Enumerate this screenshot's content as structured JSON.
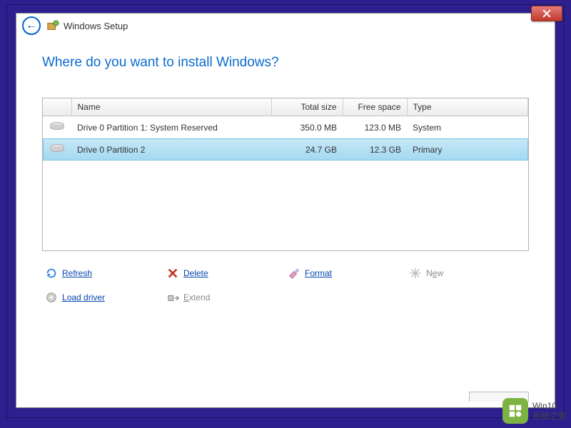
{
  "titlebar": {
    "title": "Windows Setup"
  },
  "heading": "Where do you want to install Windows?",
  "table": {
    "headers": {
      "name": "Name",
      "total_size": "Total size",
      "free_space": "Free space",
      "type": "Type"
    },
    "rows": [
      {
        "name": "Drive 0 Partition 1: System Reserved",
        "total_size": "350.0 MB",
        "free_space": "123.0 MB",
        "type": "System",
        "selected": false
      },
      {
        "name": "Drive 0 Partition 2",
        "total_size": "24.7 GB",
        "free_space": "12.3 GB",
        "type": "Primary",
        "selected": true
      }
    ]
  },
  "actions": {
    "refresh": "Refresh",
    "delete": "Delete",
    "format": "Format",
    "new": "New",
    "load_driver": "Load driver",
    "extend": "Extend"
  },
  "watermark": {
    "line1": "Win10",
    "line2": "系统之家"
  }
}
